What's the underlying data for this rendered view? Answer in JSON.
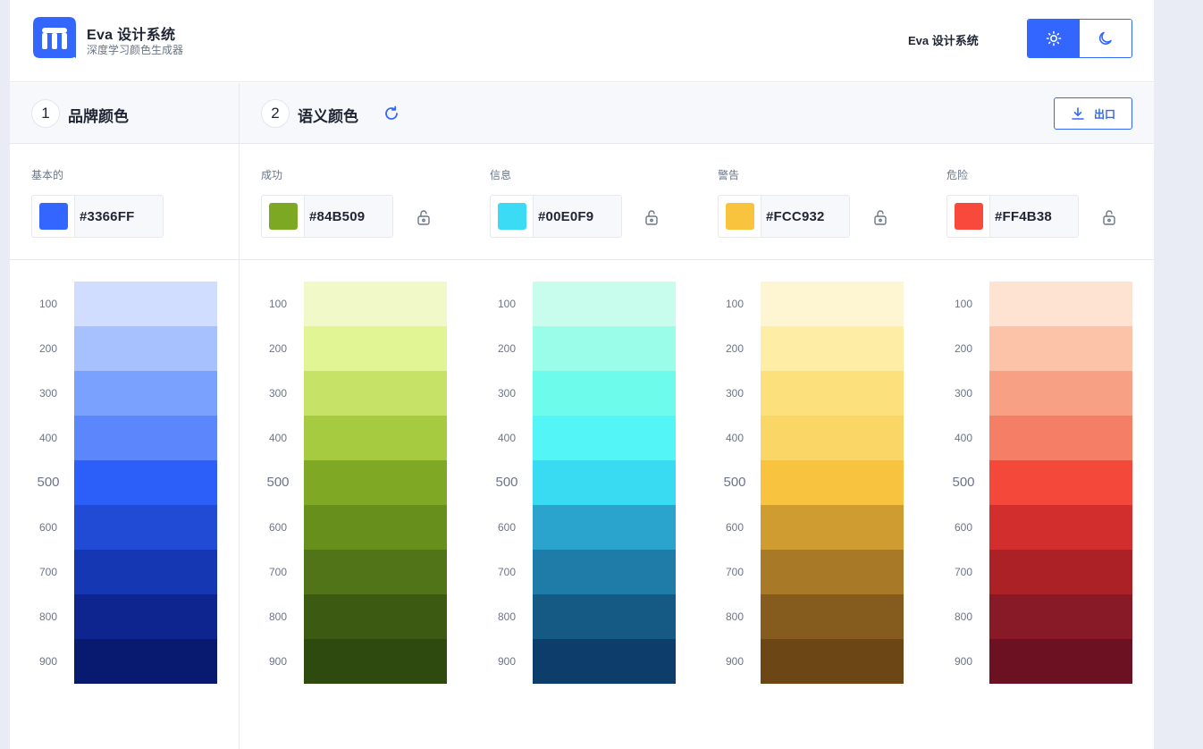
{
  "header": {
    "brand_title": "Eva 设计系统",
    "brand_subtitle": "深度学习颜色生成器",
    "nav_link": "Eva 设计系统",
    "theme_light_icon": "sun-icon",
    "theme_dark_icon": "moon-icon",
    "accent": "#3366FF"
  },
  "sections": {
    "brand": {
      "number": "1",
      "title": "品牌颜色"
    },
    "semantic": {
      "number": "2",
      "title": "语义颜色",
      "refresh_icon": "refresh-icon"
    },
    "export_label": "出口"
  },
  "shade_labels": [
    "100",
    "200",
    "300",
    "400",
    "500",
    "600",
    "700",
    "800",
    "900"
  ],
  "palettes": [
    {
      "label": "基本的",
      "hex": "#3366FF",
      "swatch": "#3366ff",
      "lockable": false,
      "shades": [
        "#d1ddfe",
        "#a6c1fe",
        "#7aa1fd",
        "#5c86fb",
        "#2c5ffa",
        "#214bd5",
        "#1637b4",
        "#0e2590",
        "#081a70"
      ]
    },
    {
      "label": "成功",
      "hex": "#84B509",
      "swatch": "#7da824",
      "lockable": true,
      "shades": [
        "#f1f9c9",
        "#e2f594",
        "#c7e367",
        "#a6cb40",
        "#7fa924",
        "#678f1c",
        "#517418",
        "#3c5a12",
        "#2f4a0e"
      ]
    },
    {
      "label": "信息",
      "hex": "#00E0F9",
      "swatch": "#3bdbf5",
      "lockable": true,
      "shades": [
        "#c8fdee",
        "#9afde9",
        "#6dfbec",
        "#53f5f6",
        "#39dbf3",
        "#2aa4cd",
        "#1f7ca9",
        "#155a84",
        "#0d3d6b"
      ]
    },
    {
      "label": "警告",
      "hex": "#FCC932",
      "swatch": "#f8c33d",
      "lockable": true,
      "shades": [
        "#fef5d2",
        "#fdeda5",
        "#fce07b",
        "#fad666",
        "#f8c33e",
        "#cf9c31",
        "#a87927",
        "#855c1d",
        "#6c4614"
      ]
    },
    {
      "label": "危险",
      "hex": "#FF4B38",
      "swatch": "#f7493c",
      "lockable": true,
      "shades": [
        "#fee3d3",
        "#fcc3a9",
        "#f8a084",
        "#f57e66",
        "#f4493a",
        "#d12e2d",
        "#ab2126",
        "#871a26",
        "#6b1122"
      ]
    }
  ]
}
